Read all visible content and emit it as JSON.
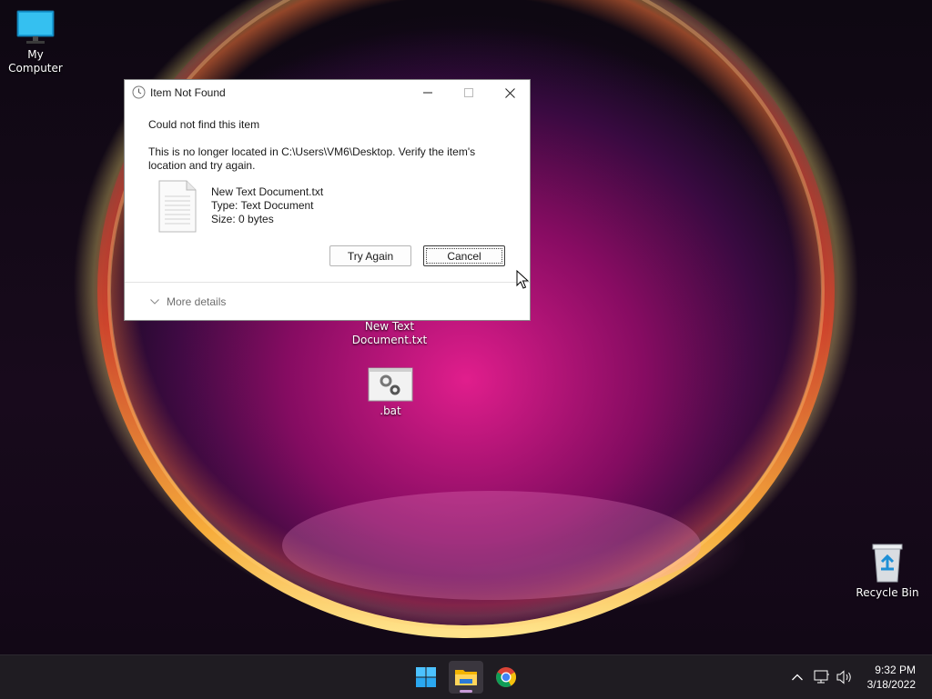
{
  "desktop": {
    "icons": [
      {
        "label": "My Computer"
      },
      {
        "label": "New Text Document.txt"
      },
      {
        "label": ".bat"
      },
      {
        "label": "Recycle Bin"
      }
    ],
    "txt_label_line1": "New Text",
    "txt_label_line2": "Document.txt"
  },
  "dialog": {
    "title": "Item Not Found",
    "heading": "Could not find this item",
    "message_line1": "This is no longer located in C:\\Users\\VM6\\Desktop. Verify the item's",
    "message_line2": "location and try again.",
    "file_name": "New Text Document.txt",
    "file_type": "Type: Text Document",
    "file_size": "Size: 0 bytes",
    "try_again_label": "Try Again",
    "cancel_label": "Cancel",
    "more_details_label": "More details"
  },
  "taskbar": {
    "time": "9:32 PM",
    "date": "3/18/2022",
    "apps": [
      "start-icon",
      "file-explorer-icon",
      "chrome-icon"
    ]
  },
  "colors": {
    "accent": "#0078d4",
    "taskbar_bg": "#1f1c22",
    "dialog_bg": "#ffffff"
  }
}
